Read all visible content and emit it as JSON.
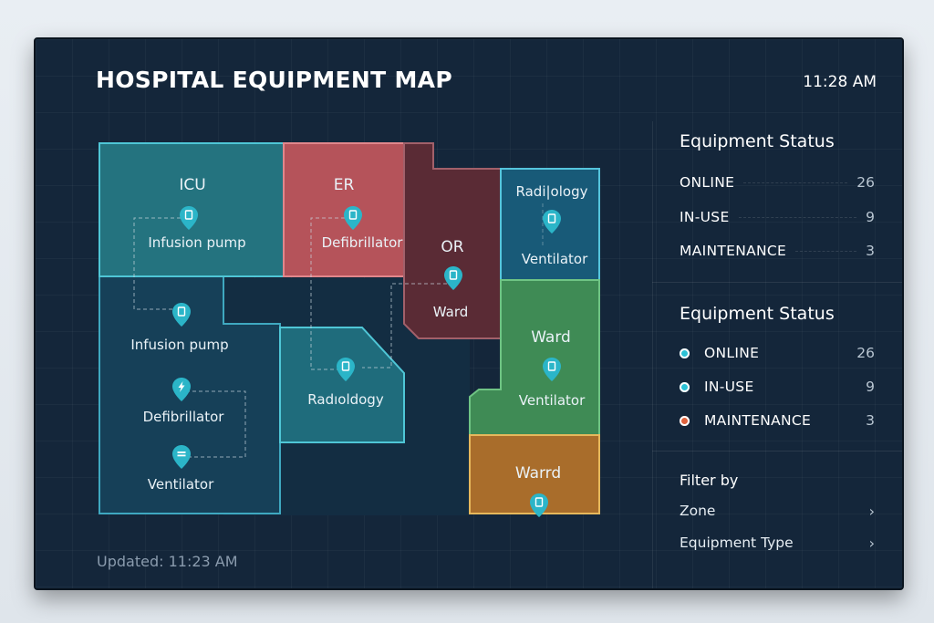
{
  "header": {
    "title": "HOSPITAL EQUIPMENT MAP",
    "time": "11:28 AM"
  },
  "footer": {
    "updated": "Updated: 11:23 AM"
  },
  "map": {
    "zones": [
      {
        "id": "icu",
        "label": "ICU",
        "color": "#24737f",
        "border": "#4fc6d6"
      },
      {
        "id": "er",
        "label": "ER",
        "color": "#b5535a",
        "border": "#e1878c"
      },
      {
        "id": "or",
        "label": "OR",
        "color": "#5a2b35",
        "border": "#a2606a"
      },
      {
        "id": "radiology-top",
        "label": "Radi|ology",
        "color": "#185a78",
        "border": "#55c4dc"
      },
      {
        "id": "ward-green",
        "label": "Ward",
        "color": "#3f8b55",
        "border": "#6fc484"
      },
      {
        "id": "ward-orange",
        "label": "Warrd",
        "color": "#a96d2b",
        "border": "#e6b85c"
      },
      {
        "id": "radiology-mid",
        "label": "Radıoldogy",
        "color": "#1f6c7c",
        "border": "#4fc6d6"
      },
      {
        "id": "lower-left",
        "label": "",
        "color": "#164058",
        "border": "#3fa8c0"
      }
    ],
    "equipment_labels": {
      "icu_pump": "Infusion pump",
      "er_defib": "Defibrillator",
      "or_ward": "Ward",
      "rad_vent": "Ventilator",
      "ward_vent": "Ventilator",
      "ll_pump": "Infusion pump",
      "ll_defib": "Defibrillator",
      "ll_vent": "Ventilator"
    },
    "pin_color": "#2bb5c8"
  },
  "status_panel": {
    "title": "Equipment Status",
    "rows": [
      {
        "name": "ONLINE",
        "value": "26"
      },
      {
        "name": "IN-USE",
        "value": "9"
      },
      {
        "name": "MAINTENANCE",
        "value": "3"
      }
    ]
  },
  "legend_panel": {
    "title": "Equipment Status",
    "rows": [
      {
        "name": "ONLINE",
        "value": "26",
        "color": "#2bc2d6"
      },
      {
        "name": "IN-USE",
        "value": "9",
        "color": "#2bc2d6"
      },
      {
        "name": "MAINTENANCE",
        "value": "3",
        "color": "#e0623d"
      }
    ]
  },
  "filter": {
    "label": "Filter by",
    "options": [
      {
        "name": "Zone",
        "icon": "chevron-right-icon"
      },
      {
        "name": "Equipment Type",
        "icon": "chevron-right-icon"
      }
    ]
  }
}
